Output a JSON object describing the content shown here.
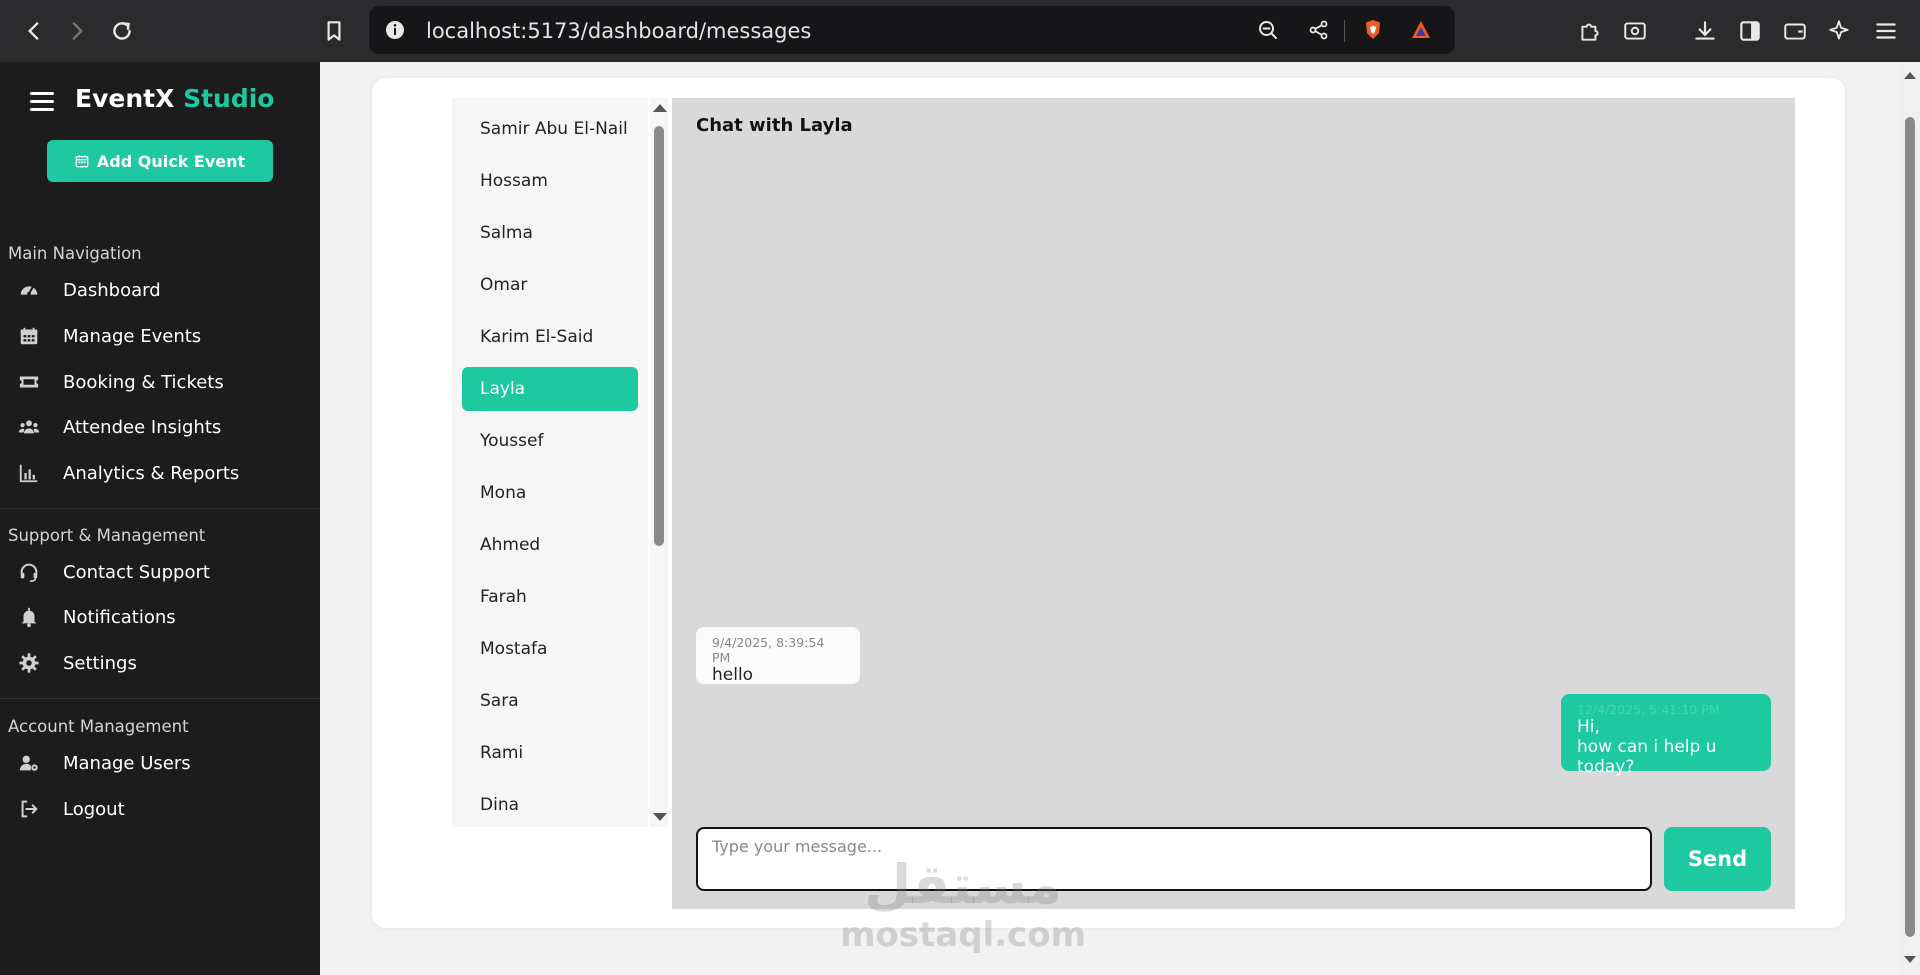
{
  "browser": {
    "url": "localhost:5173/dashboard/messages"
  },
  "sidebar": {
    "brand_main": "EventX",
    "brand_accent": "Studio",
    "quick_button": "Add Quick Event",
    "sections": [
      {
        "title": "Main Navigation",
        "items": [
          {
            "label": "Dashboard",
            "icon": "gauge-icon"
          },
          {
            "label": "Manage Events",
            "icon": "calendar-icon"
          },
          {
            "label": "Booking & Tickets",
            "icon": "ticket-icon"
          },
          {
            "label": "Attendee Insights",
            "icon": "users-icon"
          },
          {
            "label": "Analytics & Reports",
            "icon": "chart-icon"
          }
        ]
      },
      {
        "title": "Support & Management",
        "items": [
          {
            "label": "Contact Support",
            "icon": "headset-icon"
          },
          {
            "label": "Notifications",
            "icon": "bell-icon"
          },
          {
            "label": "Settings",
            "icon": "gear-icon"
          }
        ]
      },
      {
        "title": "Account Management",
        "items": [
          {
            "label": "Manage Users",
            "icon": "user-gear-icon"
          },
          {
            "label": "Logout",
            "icon": "logout-icon"
          }
        ]
      }
    ]
  },
  "contacts": [
    "Samir Abu El-Nail",
    "Hossam",
    "Salma",
    "Omar",
    "Karim El-Said",
    "Layla",
    "Youssef",
    "Mona",
    "Ahmed",
    "Farah",
    "Mostafa",
    "Sara",
    "Rami",
    "Dina"
  ],
  "active_contact_index": 5,
  "chat": {
    "title": "Chat with Layla",
    "messages": [
      {
        "direction": "in",
        "time": "9/4/2025, 8:39:54 PM",
        "text": "hello"
      },
      {
        "direction": "out",
        "time": "12/4/2025, 5:41:10 PM",
        "text": "Hi,\nhow can i help u today?"
      }
    ],
    "input_placeholder": "Type your message...",
    "send_label": "Send"
  },
  "watermark": {
    "line1": "مستقل",
    "line2": "mostaql.com"
  },
  "colors": {
    "accent": "#1ec8a0",
    "sidebar_bg": "#1c1c1c",
    "chat_bg": "#d9d9d9"
  }
}
